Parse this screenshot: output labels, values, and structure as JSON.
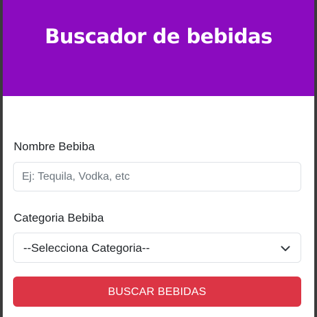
{
  "header": {
    "title": "Buscador de bebidas"
  },
  "form": {
    "name_label": "Nombre Bebiba",
    "name_placeholder": "Ej: Tequila, Vodka, etc",
    "name_value": "",
    "category_label": "Categoria Bebiba",
    "category_selected": "--Selecciona Categoria--",
    "submit_label": "BUSCAR BEBIDAS"
  },
  "colors": {
    "header_bg": "#8b0bbf",
    "button_bg": "#dc3545",
    "page_bg": "#ffffff"
  },
  "icons": {
    "select_chevron": "chevron-down-icon"
  }
}
